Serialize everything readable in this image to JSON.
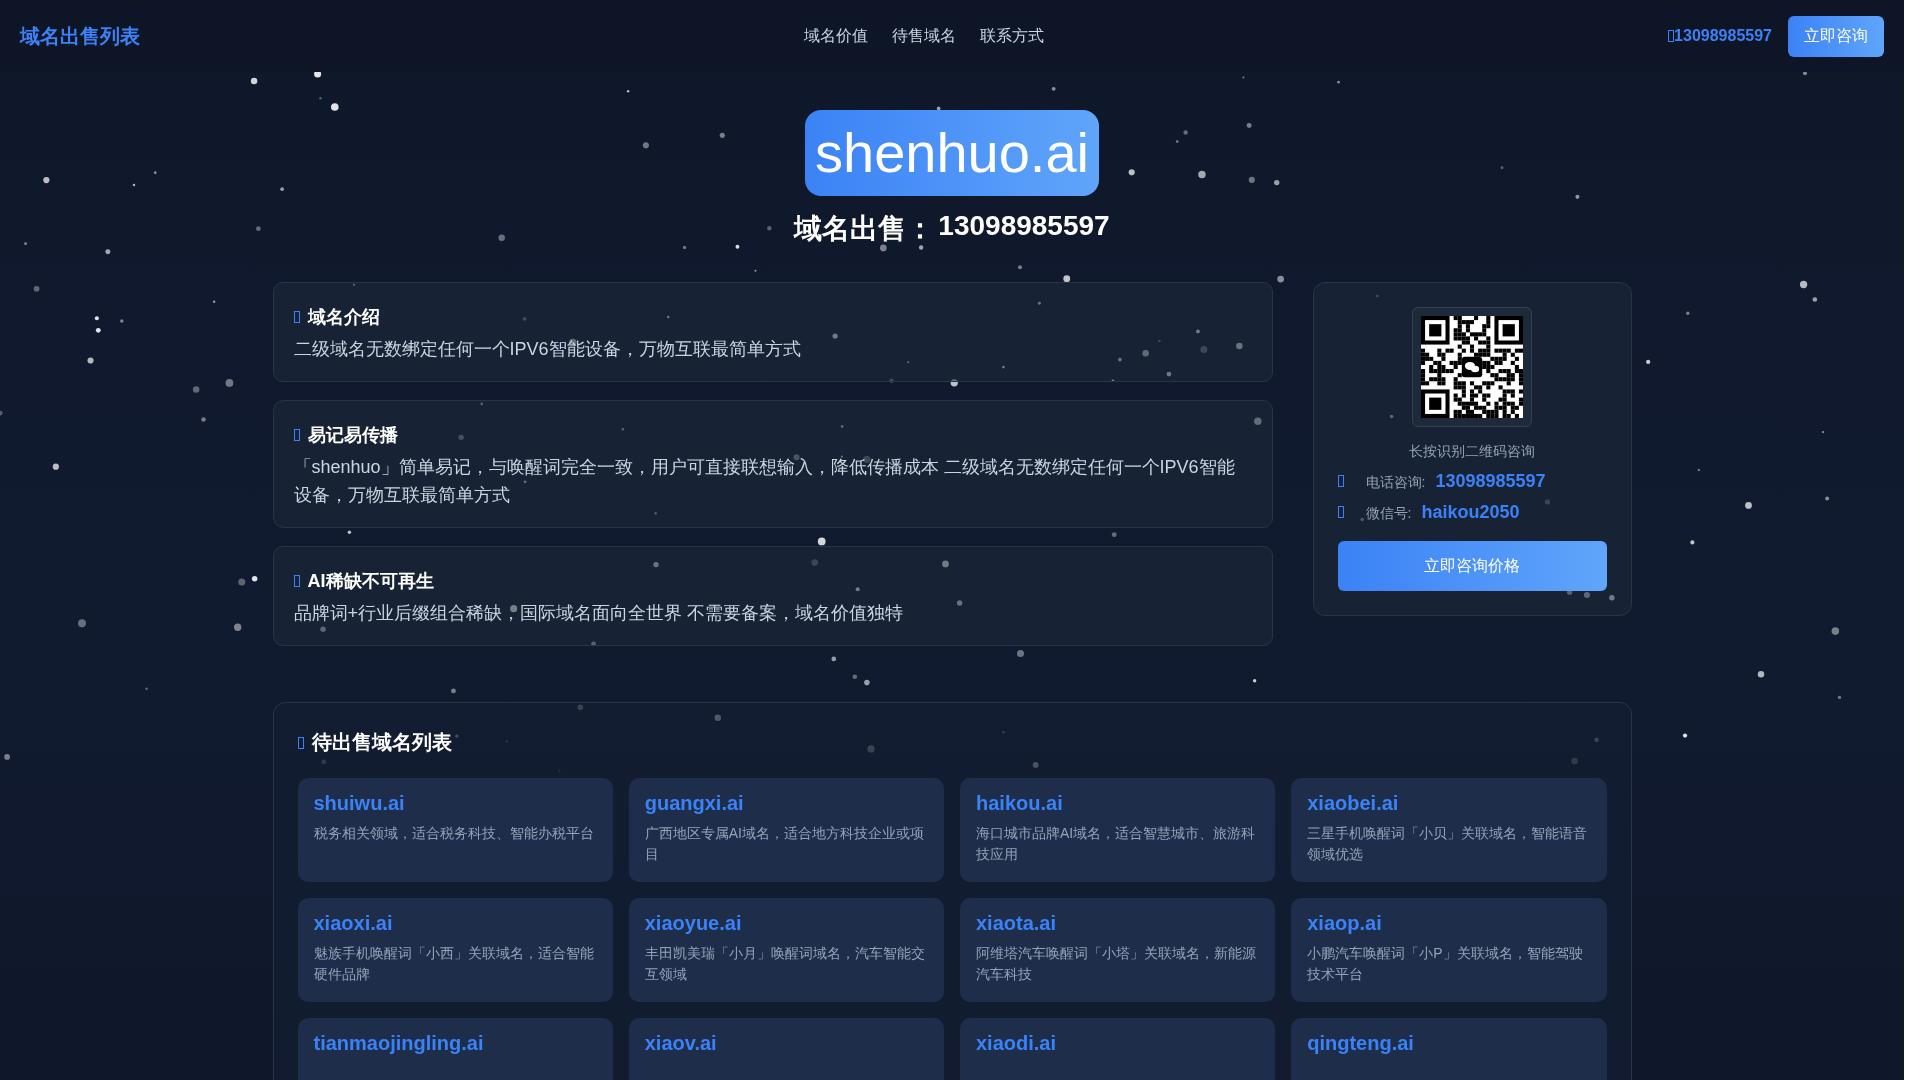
{
  "header": {
    "logo": "域名出售列表",
    "nav": [
      {
        "label": "域名价值"
      },
      {
        "label": "待售域名"
      },
      {
        "label": "联系方式"
      }
    ],
    "phone": "13098985597",
    "button": "立即咨询"
  },
  "hero": {
    "domain": "shenhuo.ai",
    "subtitle_label": "域名出售：",
    "subtitle_phone": "13098985597"
  },
  "features": [
    {
      "title": "域名介绍",
      "text": "二级域名无数绑定任何一个IPV6智能设备，万物互联最简单方式"
    },
    {
      "title": "易记易传播",
      "text": "「shenhuo」简单易记，与唤醒词完全一致，用户可直接联想输入，降低传播成本 二级域名无数绑定任何一个IPV6智能设备，万物互联最简单方式"
    },
    {
      "title": "AI稀缺不可再生",
      "text": "品牌词+行业后缀组合稀缺，国际域名面向全世界 不需要备案，域名价值独特"
    }
  ],
  "contact": {
    "qr_caption": "长按识别二维码咨询",
    "phone_label": "电话咨询:",
    "phone": "13098985597",
    "wechat_label": "微信号:",
    "wechat": "haikou2050",
    "button": "立即咨询价格"
  },
  "list": {
    "title": "待出售域名列表",
    "items": [
      {
        "domain": "shuiwu.ai",
        "desc": "税务相关领域，适合税务科技、智能办税平台"
      },
      {
        "domain": "guangxi.ai",
        "desc": "广西地区专属AI域名，适合地方科技企业或项目"
      },
      {
        "domain": "haikou.ai",
        "desc": "海口城市品牌AI域名，适合智慧城市、旅游科技应用"
      },
      {
        "domain": "xiaobei.ai",
        "desc": "三星手机唤醒词「小贝」关联域名，智能语音领域优选"
      },
      {
        "domain": "xiaoxi.ai",
        "desc": "魅族手机唤醒词「小西」关联域名，适合智能硬件品牌"
      },
      {
        "domain": "xiaoyue.ai",
        "desc": "丰田凯美瑞「小月」唤醒词域名，汽车智能交互领域"
      },
      {
        "domain": "xiaota.ai",
        "desc": "阿维塔汽车唤醒词「小塔」关联域名，新能源汽车科技"
      },
      {
        "domain": "xiaop.ai",
        "desc": "小鹏汽车唤醒词「小P」关联域名，智能驾驶技术平台"
      },
      {
        "domain": "tianmaojingling.ai"
      },
      {
        "domain": "xiaov.ai"
      },
      {
        "domain": "xiaodi.ai"
      },
      {
        "domain": "qingteng.ai"
      }
    ]
  }
}
